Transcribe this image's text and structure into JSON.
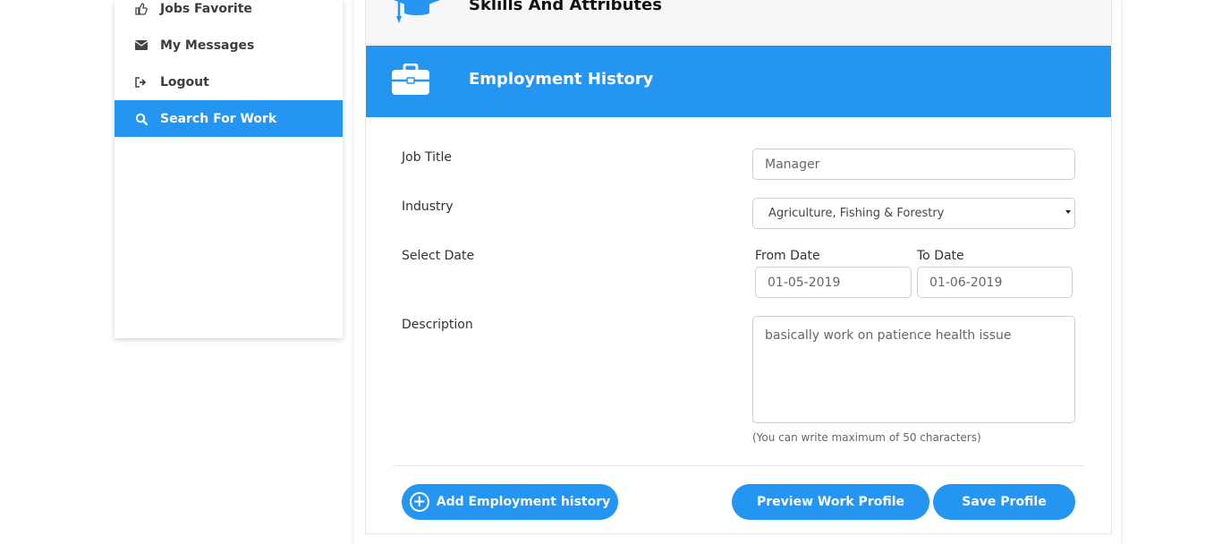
{
  "sidebar": {
    "items": [
      {
        "label": "Jobs Favorite",
        "icon": "thumbs-up-icon"
      },
      {
        "label": "My Messages",
        "icon": "envelope-icon"
      },
      {
        "label": "Logout",
        "icon": "sign-out-icon"
      },
      {
        "label": "Search For Work",
        "icon": "search-icon",
        "active": true
      }
    ]
  },
  "sections": {
    "skills_title": "Sklills And Attributes",
    "employment_title": "Employment History"
  },
  "form": {
    "job_title_label": "Job Title",
    "job_title_value": "Manager",
    "industry_label": "Industry",
    "industry_value": "Agriculture, Fishing & Forestry",
    "select_date_label": "Select Date",
    "from_date_label": "From Date",
    "from_date_value": "01-05-2019",
    "to_date_label": "To Date",
    "to_date_value": "01-06-2019",
    "description_label": "Description",
    "description_value": "basically work on patience health issue",
    "hint": "(You can write maximum of 50 characters)"
  },
  "buttons": {
    "add_employment": "Add Employment history",
    "preview": "Preview Work Profile",
    "save": "Save Profile"
  },
  "colors": {
    "accent": "#2495f0",
    "sidebar_active": "#2495f0"
  }
}
